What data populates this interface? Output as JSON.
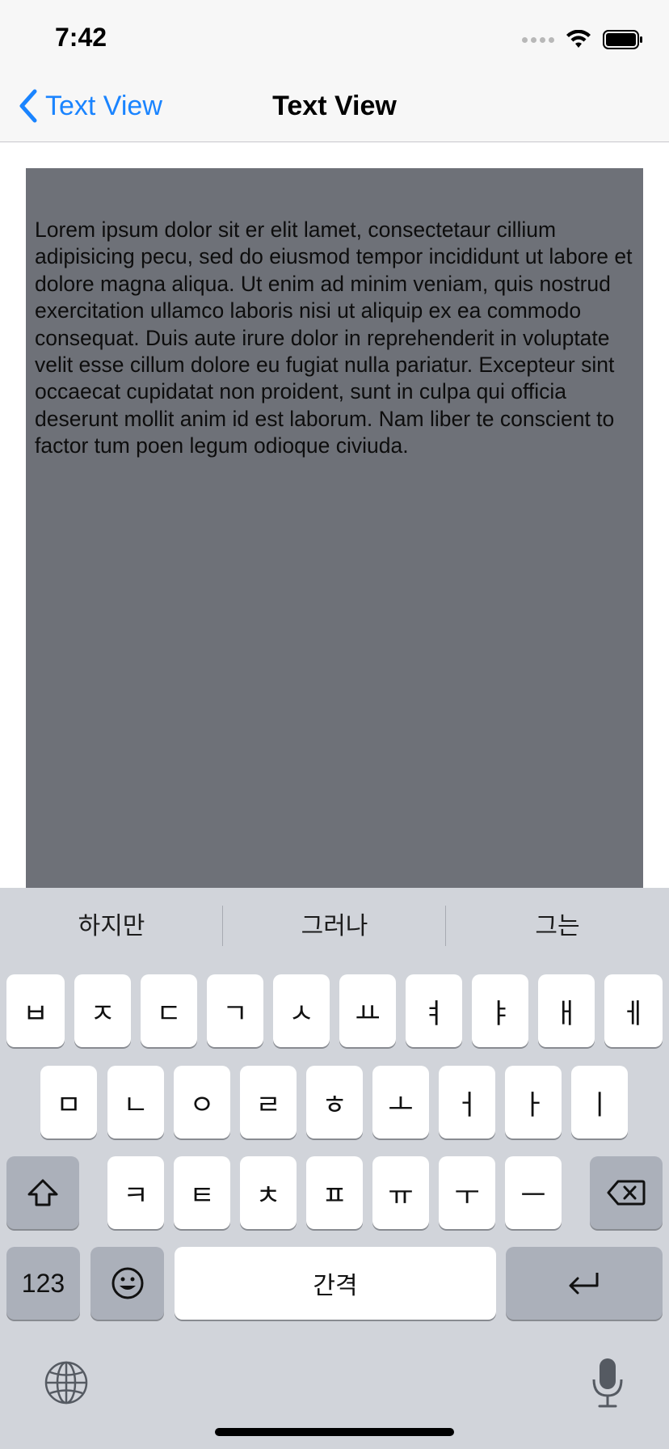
{
  "status": {
    "time": "7:42"
  },
  "nav": {
    "back_label": "Text View",
    "title": "Text View"
  },
  "text_view": {
    "content": "Lorem ipsum dolor sit er elit lamet, consectetaur cillium adipisicing pecu, sed do eiusmod tempor incididunt ut labore et dolore magna aliqua. Ut enim ad minim veniam, quis nostrud exercitation ullamco laboris nisi ut aliquip ex ea commodo consequat. Duis aute irure dolor in reprehenderit in voluptate velit esse cillum dolore eu fugiat nulla pariatur. Excepteur sint occaecat cupidatat non proident, sunt in culpa qui officia deserunt mollit anim id est laborum. Nam liber te conscient to factor tum poen legum odioque civiuda."
  },
  "keyboard": {
    "suggestions": [
      "하지만",
      "그러나",
      "그는"
    ],
    "row1": [
      "ㅂ",
      "ㅈ",
      "ㄷ",
      "ㄱ",
      "ㅅ",
      "ㅛ",
      "ㅕ",
      "ㅑ",
      "ㅐ",
      "ㅔ"
    ],
    "row2": [
      "ㅁ",
      "ㄴ",
      "ㅇ",
      "ㄹ",
      "ㅎ",
      "ㅗ",
      "ㅓ",
      "ㅏ",
      "ㅣ"
    ],
    "row3": [
      "ㅋ",
      "ㅌ",
      "ㅊ",
      "ㅍ",
      "ㅠ",
      "ㅜ",
      "ㅡ"
    ],
    "numbers_label": "123",
    "space_label": "간격",
    "icons": {
      "shift": "shift-icon",
      "backspace": "backspace-icon",
      "emoji": "emoji-icon",
      "return": "return-icon",
      "globe": "globe-icon",
      "microphone": "microphone-icon"
    }
  },
  "colors": {
    "accent": "#1a84ff",
    "text_view_bg": "#6e7178",
    "keyboard_bg": "#d1d4da",
    "key_bg": "#ffffff",
    "key_dark_bg": "#abb0ba"
  }
}
